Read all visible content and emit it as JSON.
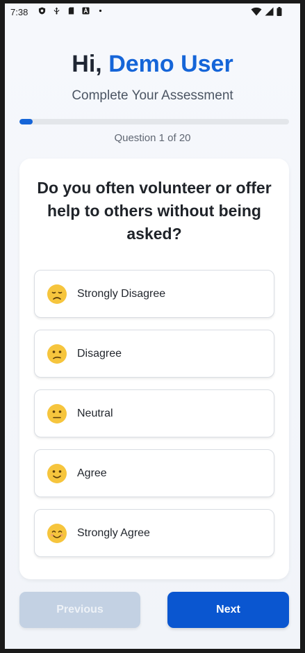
{
  "status_bar": {
    "time": "7:38",
    "left_icons": [
      "shield-icon",
      "usb-icon",
      "sdcard-icon",
      "a-icon",
      "dot-icon"
    ],
    "right_icons": [
      "wifi-icon",
      "signal-icon",
      "battery-icon"
    ]
  },
  "header": {
    "greeting_prefix": "Hi,",
    "user_name": "Demo User",
    "subtitle": "Complete Your Assessment"
  },
  "progress": {
    "value": 0.05,
    "counter_text": "Question 1 of 20"
  },
  "question": {
    "text": "Do you often volunteer or offer help to others without being asked?"
  },
  "options": [
    {
      "label": "Strongly Disagree",
      "icon": "disappointed-face-icon"
    },
    {
      "label": "Disagree",
      "icon": "confused-face-icon"
    },
    {
      "label": "Neutral",
      "icon": "neutral-face-icon"
    },
    {
      "label": "Agree",
      "icon": "slightly-smiling-face-icon"
    },
    {
      "label": "Strongly Agree",
      "icon": "smiling-face-icon"
    }
  ],
  "navigation": {
    "previous_label": "Previous",
    "next_label": "Next"
  },
  "colors": {
    "accent": "#1565d8",
    "next_button": "#0a56d0",
    "previous_button_disabled": "#c3d1e3",
    "emoji_yellow": "#f6c53d"
  }
}
